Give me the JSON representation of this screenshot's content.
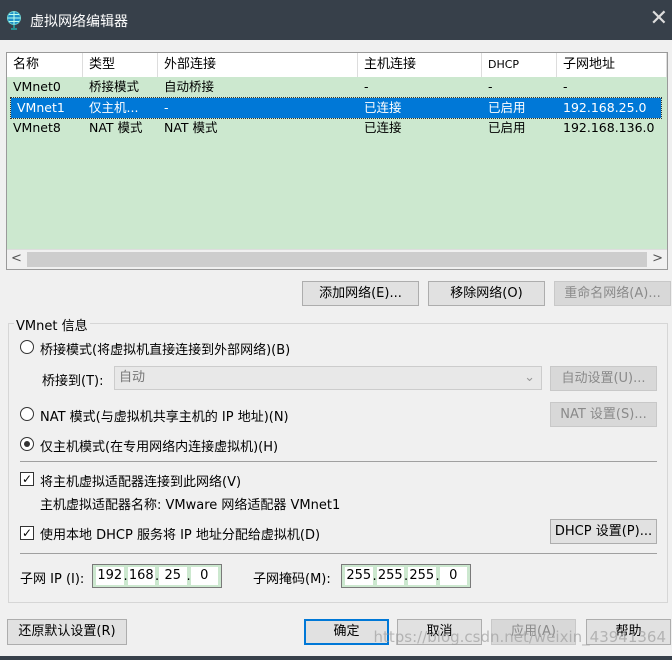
{
  "window": {
    "title": "虚拟网络编辑器",
    "close": "✕"
  },
  "table": {
    "headers": [
      "名称",
      "类型",
      "外部连接",
      "主机连接",
      "DHCP",
      "子网地址"
    ],
    "rows": [
      [
        "VMnet0",
        "桥接模式",
        "自动桥接",
        "-",
        "-",
        "-"
      ],
      [
        "VMnet1",
        "仅主机...",
        "-",
        "已连接",
        "已启用",
        "192.168.25.0"
      ],
      [
        "VMnet8",
        "NAT 模式",
        "NAT 模式",
        "已连接",
        "已启用",
        "192.168.136.0"
      ]
    ],
    "selected_index": 1,
    "scroll_left": "<",
    "scroll_right": ">"
  },
  "list_buttons": {
    "add": "添加网络(E)...",
    "remove": "移除网络(O)",
    "rename": "重命名网络(A)..."
  },
  "vmnet_info": {
    "label": "VMnet 信息",
    "bridge_mode": "桥接模式(将虚拟机直接连接到外部网络)(B)",
    "bridge_to_label": "桥接到(T):",
    "bridge_to_value": "自动",
    "auto_settings": "自动设置(U)...",
    "nat_mode": "NAT 模式(与虚拟机共享主机的 IP 地址)(N)",
    "nat_settings": "NAT 设置(S)...",
    "host_only_mode": "仅主机模式(在专用网络内连接虚拟机)(H)",
    "selected_mode": "host_only",
    "connect_adapter": "将主机虚拟适配器连接到此网络(V)",
    "connect_adapter_checked": true,
    "adapter_name": "主机虚拟适配器名称: VMware 网络适配器 VMnet1",
    "use_dhcp": "使用本地 DHCP 服务将 IP 地址分配给虚拟机(D)",
    "use_dhcp_checked": true,
    "dhcp_settings": "DHCP 设置(P)...",
    "subnet_ip_label": "子网 IP (I):",
    "subnet_ip": [
      "192",
      "168",
      "25",
      "0"
    ],
    "subnet_mask_label": "子网掩码(M):",
    "subnet_mask": [
      "255",
      "255",
      "255",
      "0"
    ]
  },
  "footer": {
    "restore": "还原默认设置(R)",
    "ok": "确定",
    "cancel": "取消",
    "apply": "应用(A)",
    "help": "帮助"
  },
  "watermark": "https://blog.csdn.net/weixin_43941364"
}
